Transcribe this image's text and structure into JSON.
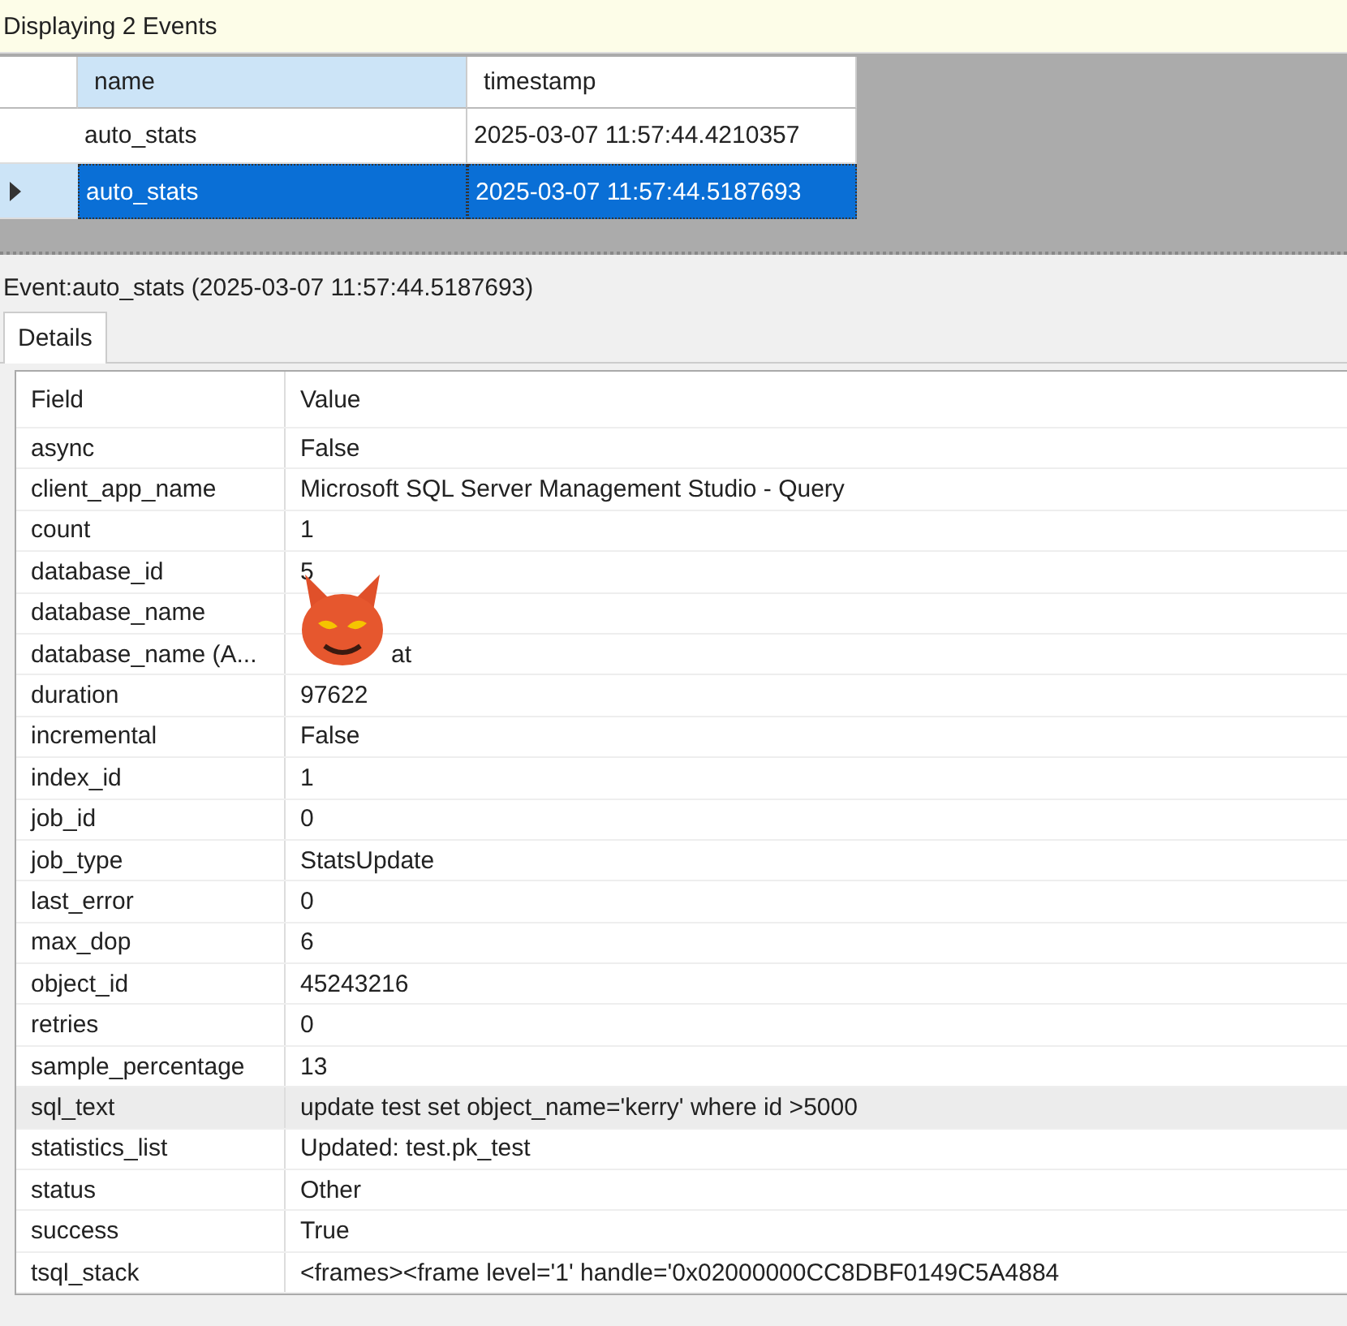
{
  "status": "Displaying 2 Events",
  "grid": {
    "columns": [
      {
        "label": "name",
        "selected": true
      },
      {
        "label": "timestamp",
        "selected": false
      }
    ],
    "rows": [
      {
        "cells": [
          "auto_stats",
          "2025-03-07 11:57:44.4210357"
        ],
        "selected": false
      },
      {
        "cells": [
          "auto_stats",
          "2025-03-07 11:57:44.5187693"
        ],
        "selected": true
      }
    ]
  },
  "event_title": "Event:auto_stats (2025-03-07 11:57:44.5187693)",
  "tabs": [
    {
      "label": "Details",
      "selected": true
    }
  ],
  "details": {
    "columns": [
      "Field",
      "Value"
    ],
    "rows": [
      {
        "field": "async",
        "value": "False",
        "selected": false
      },
      {
        "field": "client_app_name",
        "value": "Microsoft SQL Server Management Studio - Query",
        "selected": false
      },
      {
        "field": "count",
        "value": "1",
        "selected": false
      },
      {
        "field": "database_id",
        "value": "5",
        "selected": false
      },
      {
        "field": "database_name",
        "selected": false
      },
      {
        "field": "database_name (A...",
        "value": "at",
        "selected": false
      },
      {
        "field": "duration",
        "value": "97622",
        "selected": false
      },
      {
        "field": "incremental",
        "value": "False",
        "selected": false
      },
      {
        "field": "index_id",
        "value": "1",
        "selected": false
      },
      {
        "field": "job_id",
        "value": "0",
        "selected": false
      },
      {
        "field": "job_type",
        "value": "StatsUpdate",
        "selected": false
      },
      {
        "field": "last_error",
        "value": "0",
        "selected": false
      },
      {
        "field": "max_dop",
        "value": "6",
        "selected": false
      },
      {
        "field": "object_id",
        "value": "45243216",
        "selected": false
      },
      {
        "field": "retries",
        "value": "0",
        "selected": false
      },
      {
        "field": "sample_percentage",
        "value": "13",
        "selected": false
      },
      {
        "field": "sql_text",
        "value": "update test set object_name='kerry' where id >5000",
        "selected": true
      },
      {
        "field": "statistics_list",
        "value": "Updated: test.pk_test",
        "selected": false
      },
      {
        "field": "status",
        "value": "Other",
        "selected": false
      },
      {
        "field": "success",
        "value": "True",
        "selected": false
      },
      {
        "field": "tsql_stack",
        "value": "<frames><frame level='1' handle='0x02000000CC8DBF0149C5A4884",
        "selected": false
      }
    ]
  }
}
